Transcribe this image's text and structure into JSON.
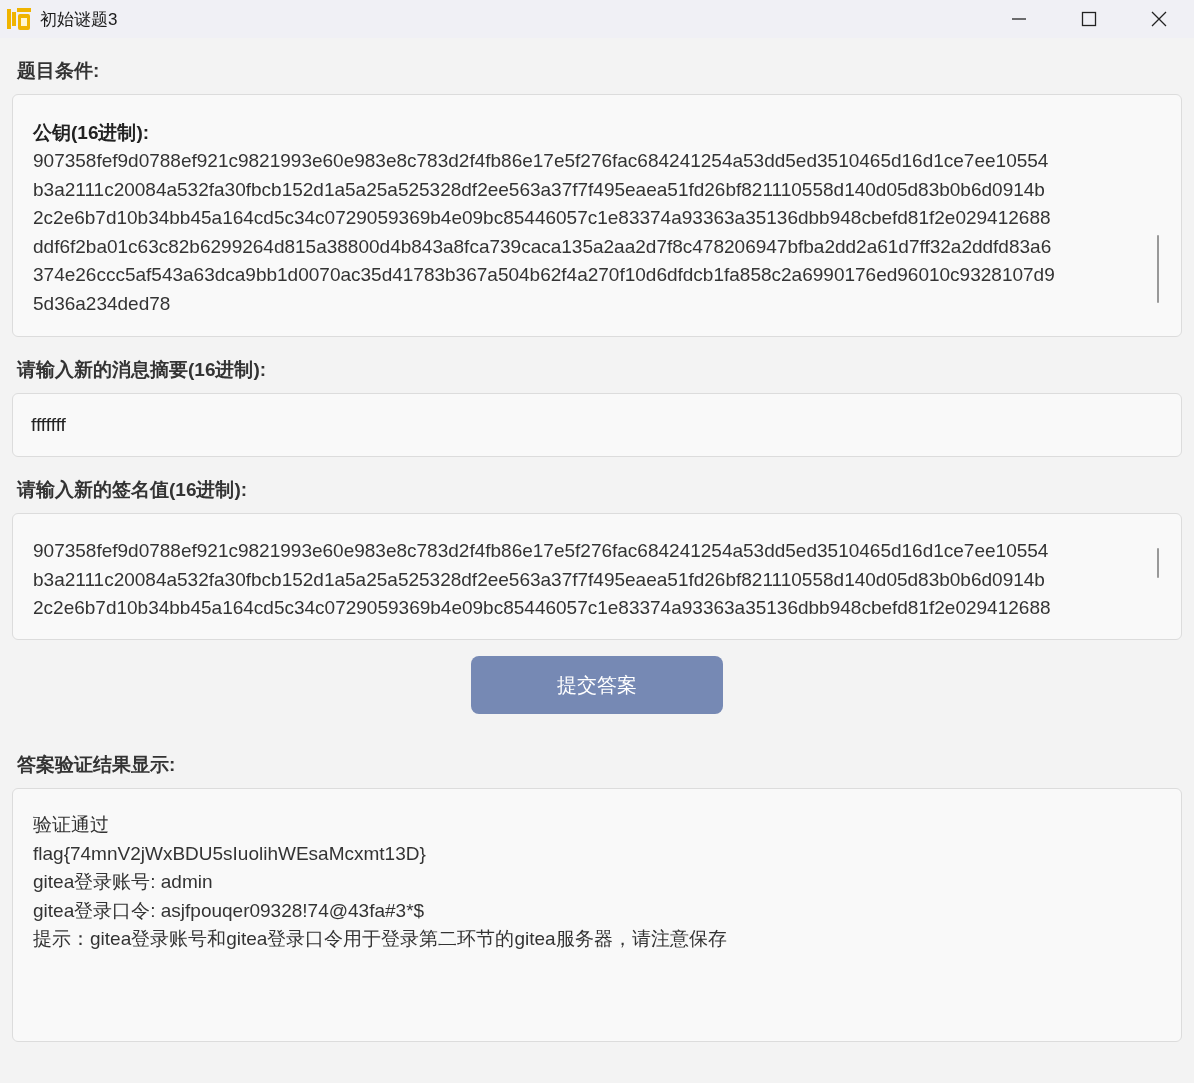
{
  "window": {
    "title": "初始谜题3"
  },
  "conditions": {
    "label": "题目条件:",
    "heading": "公钥(16进制):",
    "lines": [
      "907358fef9d0788ef921c9821993e60e983e8c783d2f4fb86e17e5f276fac684241254a53dd5ed3510465d16d1ce7ee10554",
      "b3a2111c20084a532fa30fbcb152d1a5a25a525328df2ee563a37f7f495eaea51fd26bf821110558d140d05d83b0b6d0914b",
      "2c2e6b7d10b34bb45a164cd5c34c0729059369b4e09bc85446057c1e83374a93363a35136dbb948cbefd81f2e029412688",
      "ddf6f2ba01c63c82b6299264d815a38800d4b843a8fca739caca135a2aa2d7f8c478206947bfba2dd2a61d7ff32a2ddfd83a6",
      "374e26ccc5af543a63dca9bb1d0070ac35d41783b367a504b62f4a270f10d6dfdcb1fa858c2a6990176ed96010c9328107d9",
      "5d36a234ded78"
    ]
  },
  "digest": {
    "label": "请输入新的消息摘要(16进制):",
    "value": "fffffff"
  },
  "signature": {
    "label": "请输入新的签名值(16进制):",
    "lines": [
      "907358fef9d0788ef921c9821993e60e983e8c783d2f4fb86e17e5f276fac684241254a53dd5ed3510465d16d1ce7ee10554",
      "b3a2111c20084a532fa30fbcb152d1a5a25a525328df2ee563a37f7f495eaea51fd26bf821110558d140d05d83b0b6d0914b",
      "2c2e6b7d10b34bb45a164cd5c34c0729059369b4e09bc85446057c1e83374a93363a35136dbb948cbefd81f2e029412688"
    ]
  },
  "submit_button": "提交答案",
  "result": {
    "label": "答案验证结果显示:",
    "lines": [
      "验证通过",
      "flag{74mnV2jWxBDU5sIuolihWEsaMcxmt13D}",
      "gitea登录账号: admin",
      "gitea登录口令: asjfpouqer09328!74@43fa#3*$",
      "提示：gitea登录账号和gitea登录口令用于登录第二环节的gitea服务器，请注意保存"
    ]
  }
}
